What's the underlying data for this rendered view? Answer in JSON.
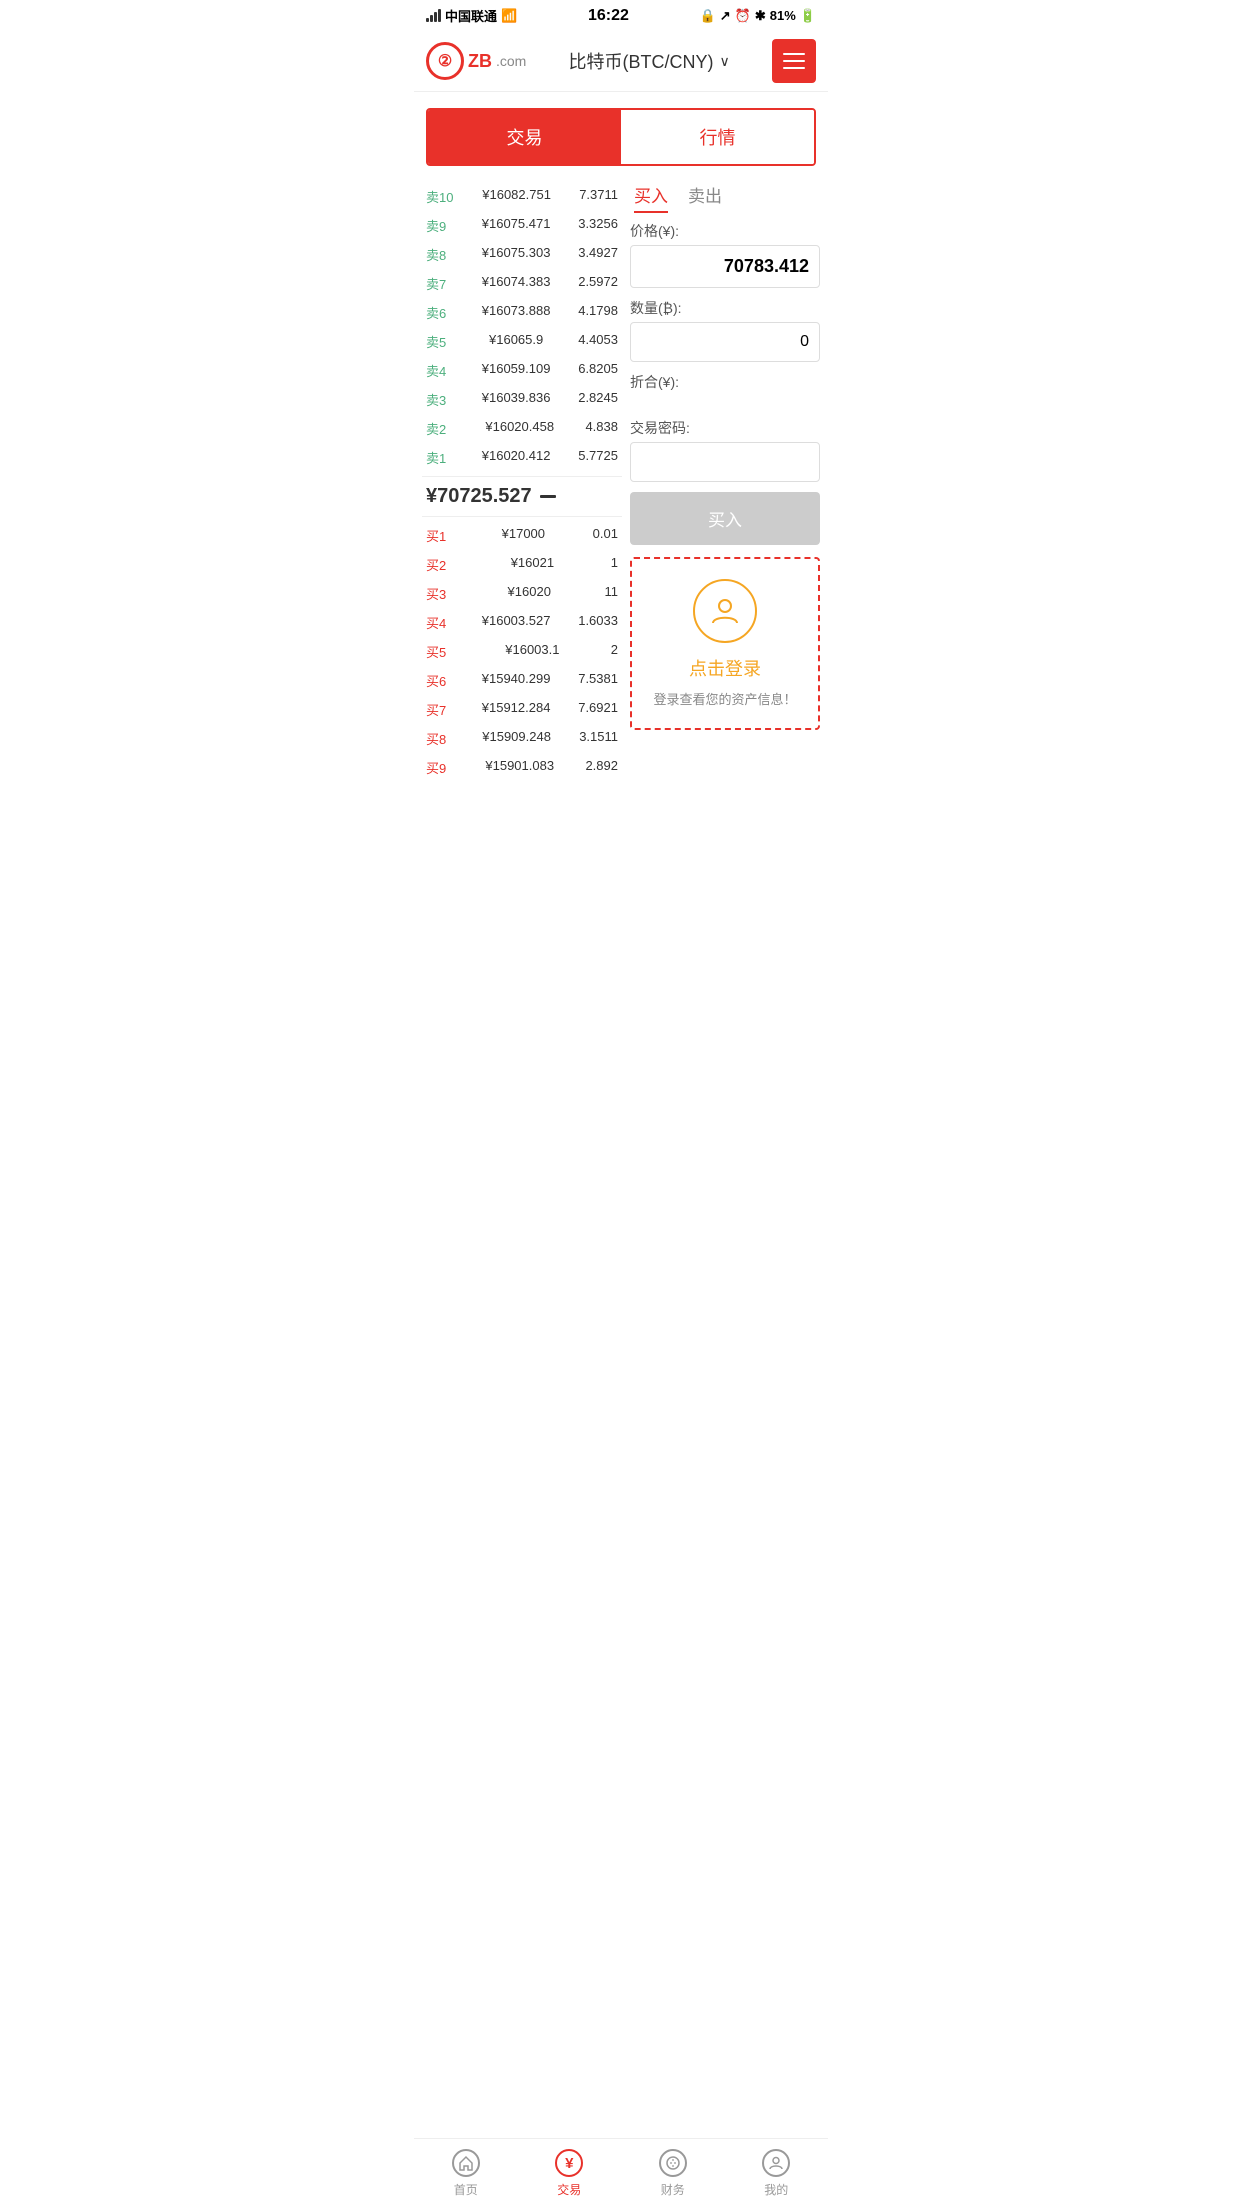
{
  "statusBar": {
    "carrier": "中国联通",
    "time": "16:22",
    "battery": "81%"
  },
  "header": {
    "logoText": "ZB",
    "logoDomain": ".com",
    "title": "比特币(BTC/CNY)",
    "menuLabel": "menu"
  },
  "mainTabs": [
    {
      "id": "trade",
      "label": "交易",
      "active": true
    },
    {
      "id": "market",
      "label": "行情",
      "active": false
    }
  ],
  "orderBook": {
    "sellOrders": [
      {
        "label": "卖10",
        "price": "¥16082.751",
        "qty": "7.3711"
      },
      {
        "label": "卖9",
        "price": "¥16075.471",
        "qty": "3.3256"
      },
      {
        "label": "卖8",
        "price": "¥16075.303",
        "qty": "3.4927"
      },
      {
        "label": "卖7",
        "price": "¥16074.383",
        "qty": "2.5972"
      },
      {
        "label": "卖6",
        "price": "¥16073.888",
        "qty": "4.1798"
      },
      {
        "label": "卖5",
        "price": "¥16065.9",
        "qty": "4.4053"
      },
      {
        "label": "卖4",
        "price": "¥16059.109",
        "qty": "6.8205"
      },
      {
        "label": "卖3",
        "price": "¥16039.836",
        "qty": "2.8245"
      },
      {
        "label": "卖2",
        "price": "¥16020.458",
        "qty": "4.838"
      },
      {
        "label": "卖1",
        "price": "¥16020.412",
        "qty": "5.7725"
      }
    ],
    "currentPrice": "¥70725.527",
    "buyOrders": [
      {
        "label": "买1",
        "price": "¥17000",
        "qty": "0.01"
      },
      {
        "label": "买2",
        "price": "¥16021",
        "qty": "1"
      },
      {
        "label": "买3",
        "price": "¥16020",
        "qty": "11"
      },
      {
        "label": "买4",
        "price": "¥16003.527",
        "qty": "1.6033"
      },
      {
        "label": "买5",
        "price": "¥16003.1",
        "qty": "2"
      },
      {
        "label": "买6",
        "price": "¥15940.299",
        "qty": "7.5381"
      },
      {
        "label": "买7",
        "price": "¥15912.284",
        "qty": "7.6921"
      },
      {
        "label": "买8",
        "price": "¥15909.248",
        "qty": "3.1511"
      },
      {
        "label": "买9",
        "price": "¥15901.083",
        "qty": "2.892"
      }
    ]
  },
  "tradePanel": {
    "tabs": [
      {
        "id": "buy",
        "label": "买入",
        "active": true
      },
      {
        "id": "sell",
        "label": "卖出",
        "active": false
      }
    ],
    "priceLabel": "价格(¥):",
    "priceValue": "70783.412",
    "qtyLabel": "数量(₿):",
    "qtyValue": "0",
    "totalLabel": "折合(¥):",
    "totalValue": "",
    "passwordLabel": "交易密码:",
    "passwordValue": "",
    "buyButton": "买入"
  },
  "loginPrompt": {
    "text": "点击登录",
    "subtext": "登录查看您的资产信息！"
  },
  "bottomNav": [
    {
      "id": "home",
      "label": "首页",
      "icon": "★",
      "active": false
    },
    {
      "id": "trade",
      "label": "交易",
      "icon": "¥",
      "active": true
    },
    {
      "id": "finance",
      "label": "财务",
      "icon": "💰",
      "active": false
    },
    {
      "id": "mine",
      "label": "我的",
      "icon": "👤",
      "active": false
    }
  ]
}
